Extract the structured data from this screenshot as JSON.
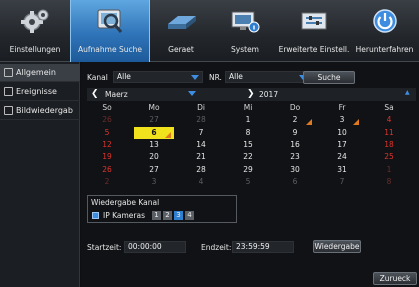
{
  "tabs": [
    {
      "label": "Einstellungen",
      "icon": "gear-icon"
    },
    {
      "label": "Aufnahme Suche",
      "icon": "magnifier-icon"
    },
    {
      "label": "Geraet",
      "icon": "hard-drive-icon"
    },
    {
      "label": "System",
      "icon": "monitor-info-icon"
    },
    {
      "label": "Erweiterte Einstell.",
      "icon": "advanced-settings-icon"
    },
    {
      "label": "Herunterfahren",
      "icon": "power-icon"
    }
  ],
  "sidebar": {
    "items": [
      {
        "label": "Allgemein",
        "icon": "general-icon"
      },
      {
        "label": "Ereignisse",
        "icon": "events-icon"
      },
      {
        "label": "Bildwiedergab",
        "icon": "image-playback-icon"
      }
    ]
  },
  "filters": {
    "kanal_label": "Kanal",
    "kanal_value": "Alle",
    "nr_label": "NR.",
    "nr_value": "Alle",
    "search_button": "Suche"
  },
  "calendar": {
    "month": "Maerz",
    "year": "2017",
    "weekdays": [
      "So",
      "Mo",
      "Di",
      "Mi",
      "Do",
      "Fr",
      "Sa"
    ],
    "weeks": [
      [
        "26",
        "27",
        "28",
        "1",
        "2",
        "3",
        "4"
      ],
      [
        "5",
        "6",
        "7",
        "8",
        "9",
        "10",
        "11"
      ],
      [
        "12",
        "13",
        "14",
        "15",
        "16",
        "17",
        "18"
      ],
      [
        "19",
        "20",
        "21",
        "22",
        "23",
        "24",
        "25"
      ],
      [
        "26",
        "27",
        "28",
        "29",
        "30",
        "31",
        "1"
      ],
      [
        "2",
        "3",
        "4",
        "5",
        "6",
        "7",
        "8"
      ]
    ],
    "selected_day": "6",
    "days_with_recordings": [
      "2",
      "3",
      "6"
    ]
  },
  "playback": {
    "title": "Wiedergabe Kanal",
    "cameras_label": "IP Kameras",
    "channels": [
      "1",
      "2",
      "3",
      "4"
    ],
    "selected_channel": "3"
  },
  "time": {
    "start_label": "Startzeit:",
    "start_value": "00:00:00",
    "end_label": "Endzeit:",
    "end_value": "23:59:59",
    "playback_button": "Wiedergabe"
  },
  "back_button": "Zurueck",
  "colors": {
    "accent_blue": "#2f74b8",
    "selected_day": "#f0e21c",
    "weekend_red": "#e0342c",
    "recording_marker": "#e07a1f"
  }
}
